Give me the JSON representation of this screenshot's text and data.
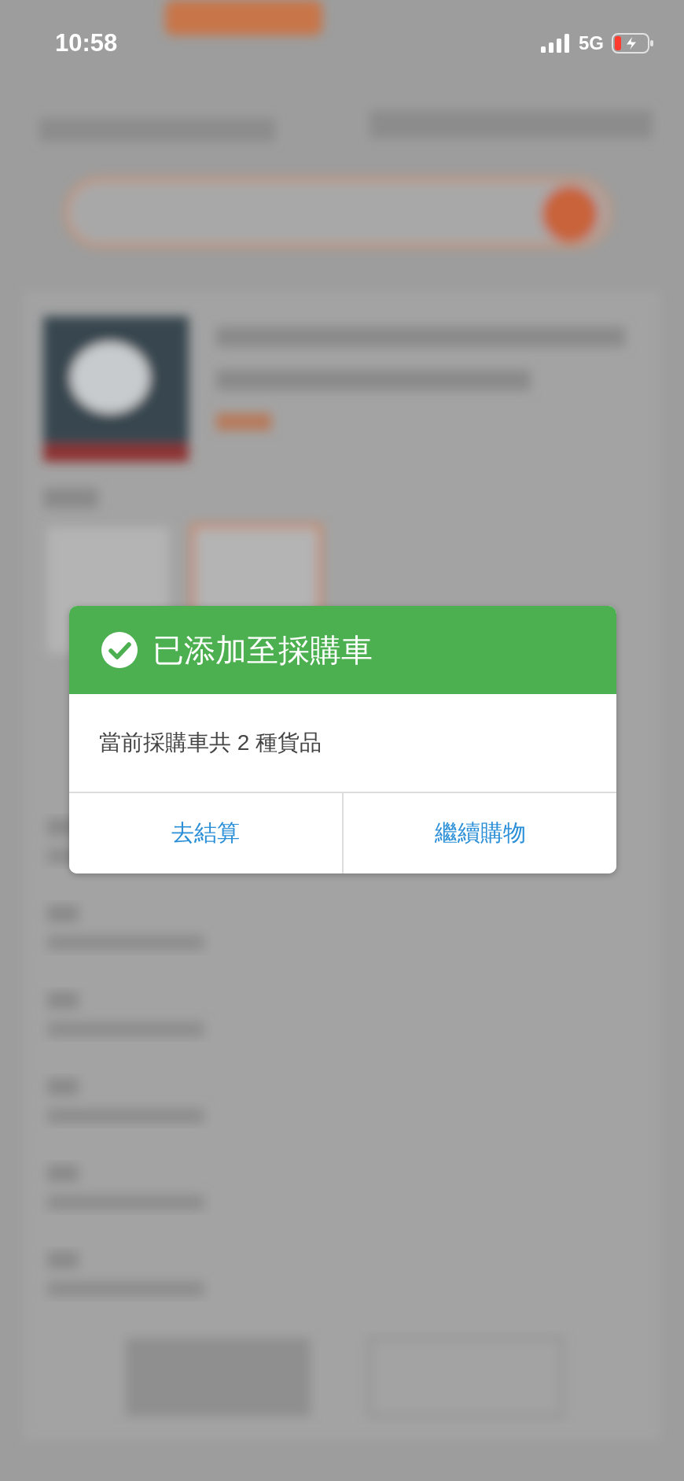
{
  "status_bar": {
    "time": "10:58",
    "network": "5G"
  },
  "dialog": {
    "title": "已添加至採購車",
    "message": "當前採購車共 2 種貨品",
    "buttons": [
      {
        "label": "去結算"
      },
      {
        "label": "繼續購物"
      }
    ]
  }
}
